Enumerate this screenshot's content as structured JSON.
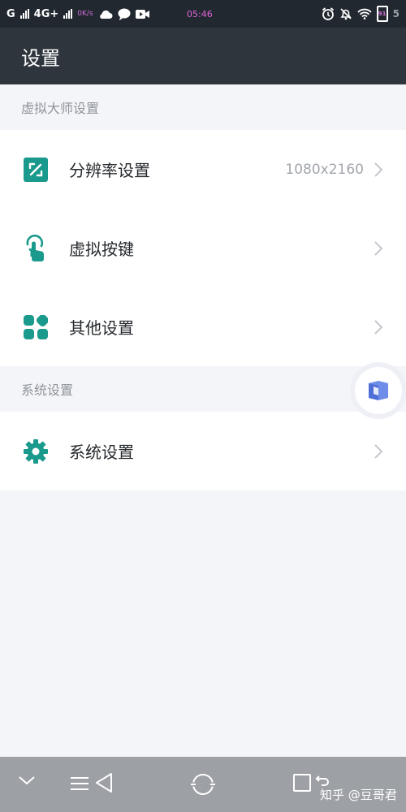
{
  "status_bar": {
    "carrier": "G",
    "network": "4G+",
    "speed": "0K/s",
    "time": "05:46",
    "battery_level": "91",
    "battery_text": "5"
  },
  "header": {
    "title": "设置"
  },
  "sections": [
    {
      "title": "虚拟大师设置",
      "items": [
        {
          "label": "分辨率设置",
          "value": "1080x2160",
          "icon": "resolution-icon"
        },
        {
          "label": "虚拟按键",
          "value": "",
          "icon": "touch-hand-icon"
        },
        {
          "label": "其他设置",
          "value": "",
          "icon": "grid-apps-icon"
        }
      ]
    },
    {
      "title": "系统设置",
      "items": [
        {
          "label": "系统设置",
          "value": "",
          "icon": "gear-icon"
        }
      ]
    }
  ],
  "colors": {
    "accent": "#1a9a8c",
    "header_bg": "#2e353d",
    "status_bg": "#22282f",
    "nav_bg": "#9da0a5"
  },
  "watermark": {
    "text": "知乎 @豆哥君"
  }
}
